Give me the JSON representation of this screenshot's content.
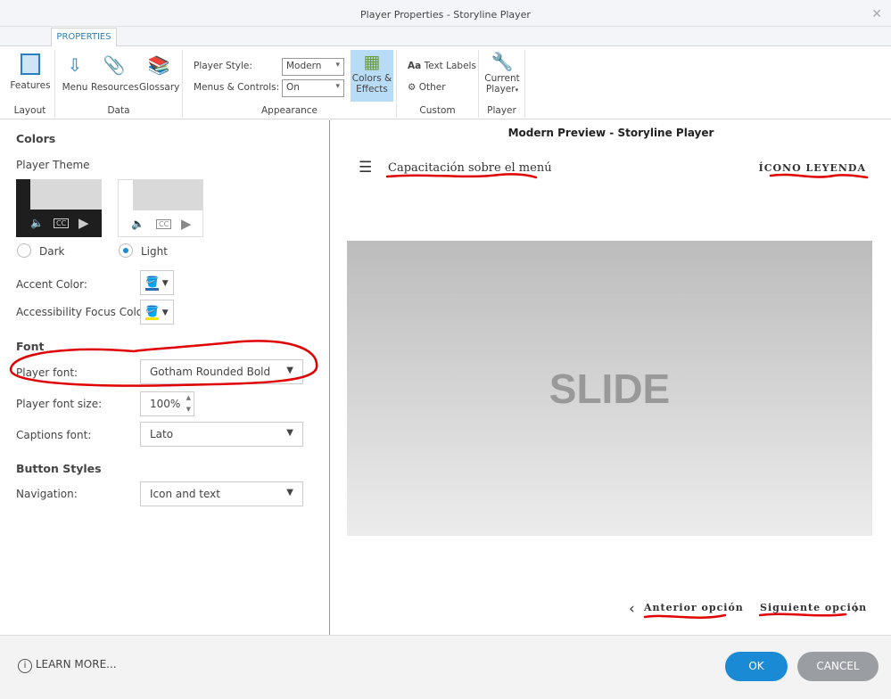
{
  "window": {
    "title": "Player Properties - Storyline Player",
    "close": "✕"
  },
  "ribbon": {
    "tab": "PROPERTIES",
    "groups": {
      "layout": "Layout",
      "data": "Data",
      "appearance": "Appearance",
      "custom": "Custom",
      "player": "Player"
    },
    "buttons": {
      "features": "Features",
      "menu": "Menu",
      "resources": "Resources",
      "glossary": "Glossary",
      "colors_effects_1": "Colors &",
      "colors_effects_2": "Effects",
      "text_labels": "Text Labels",
      "text_labels_icon": "Aa",
      "other": "Other",
      "current_player_1": "Current",
      "current_player_2": "Player"
    },
    "player_style_label": "Player Style:",
    "player_style": "Modern",
    "menus_controls_label": "Menus & Controls:",
    "menus_controls": "On"
  },
  "left": {
    "colors_heading": "Colors",
    "player_theme": "Player Theme",
    "dark": "Dark",
    "light": "Light",
    "selected_theme": "Light",
    "accent_label": "Accent Color:",
    "accent_color": "#2b6cb8",
    "focus_label": "Accessibility Focus Color:",
    "focus_color": "#f2e600",
    "font_heading": "Font",
    "player_font_label": "Player font:",
    "player_font": "Gotham Rounded Bold",
    "font_size_label": "Player font size:",
    "font_size": "100%",
    "captions_label": "Captions font:",
    "captions_font": "Lato",
    "button_styles": "Button Styles",
    "navigation_label": "Navigation:",
    "navigation": "Icon and text",
    "cc": "CC"
  },
  "preview": {
    "heading": "Modern Preview - Storyline Player",
    "course_title": "Capacitación sobre el menú",
    "legend": "ÍCONO LEYENDA",
    "slide": "SLIDE",
    "prev": "Anterior opción",
    "next": "Siguiente opción"
  },
  "footer": {
    "learn_more": "LEARN MORE...",
    "ok": "OK",
    "cancel": "CANCEL"
  },
  "colors": {
    "accent": "#1a8ad4",
    "annotation": "#e00000"
  }
}
